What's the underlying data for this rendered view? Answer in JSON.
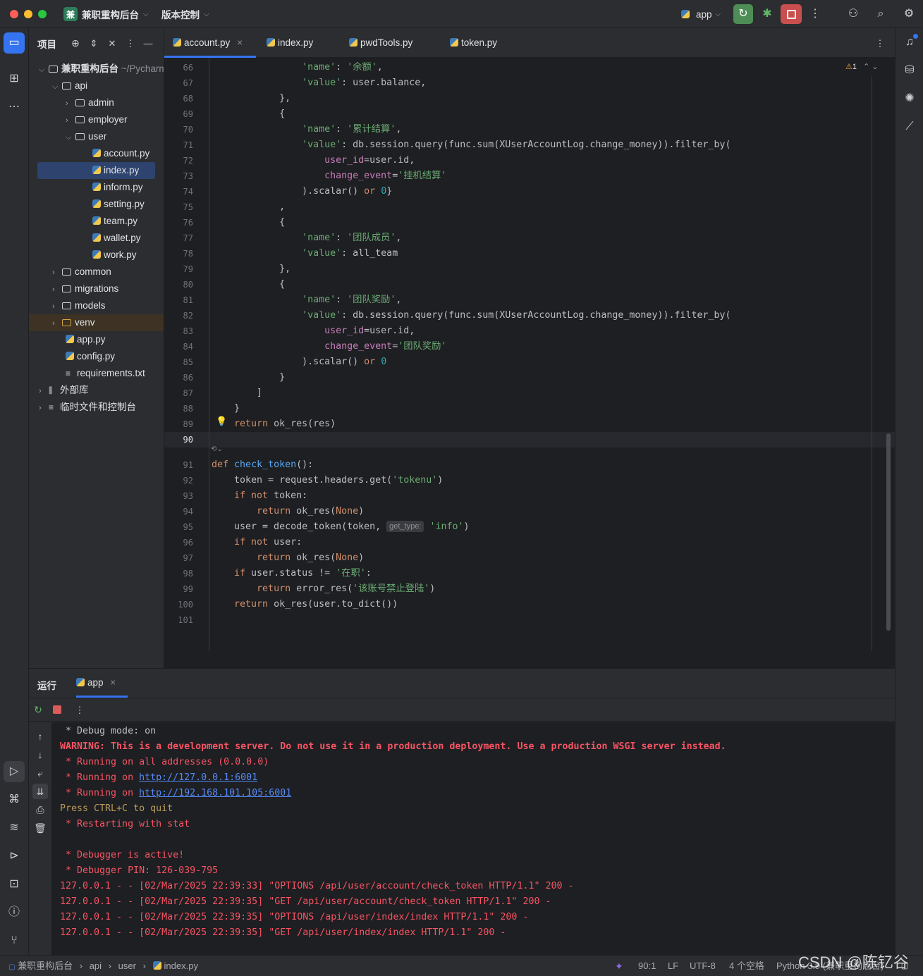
{
  "titlebar": {
    "project_badge": "兼",
    "project_name": "兼职重构后台",
    "vcs": "版本控制",
    "run_config": "app"
  },
  "project_panel": {
    "title": "项目",
    "root": "兼职重构后台",
    "root_path": "~/PycharmProjects",
    "items": [
      "api",
      "admin",
      "employer",
      "user",
      "account.py",
      "index.py",
      "inform.py",
      "setting.py",
      "team.py",
      "wallet.py",
      "work.py",
      "common",
      "migrations",
      "models",
      "venv",
      "app.py",
      "config.py",
      "requirements.txt",
      "外部库",
      "临时文件和控制台"
    ]
  },
  "tabs": [
    "account.py",
    "index.py",
    "pwdTools.py",
    "token.py"
  ],
  "editor": {
    "warning_count": "1",
    "param_hint": "get_type:",
    "line_numbers": [
      "66",
      "67",
      "68",
      "69",
      "70",
      "71",
      "72",
      "73",
      "74",
      "75",
      "76",
      "77",
      "78",
      "79",
      "80",
      "81",
      "82",
      "83",
      "84",
      "85",
      "86",
      "87",
      "88",
      "89",
      "90",
      "91",
      "92",
      "93",
      "94",
      "95",
      "96",
      "97",
      "98",
      "99",
      "100",
      "101"
    ]
  },
  "run_panel": {
    "title": "运行",
    "tab": "app",
    "console": [
      " * Debug mode: on",
      "WARNING: This is a development server. Do not use it in a production deployment. Use a production WSGI server instead.",
      " * Running on all addresses (0.0.0.0)",
      " * Running on ",
      "http://127.0.0.1:6001",
      " * Running on ",
      "http://192.168.101.105:6001",
      "Press CTRL+C to quit",
      " * Restarting with stat",
      " * Debugger is active!",
      " * Debugger PIN: 126-039-795",
      "127.0.0.1 - - [02/Mar/2025 22:39:33] \"OPTIONS /api/user/account/check_token HTTP/1.1\" 200 -",
      "127.0.0.1 - - [02/Mar/2025 22:39:35] \"GET /api/user/account/check_token HTTP/1.1\" 200 -",
      "127.0.0.1 - - [02/Mar/2025 22:39:35] \"OPTIONS /api/user/index/index HTTP/1.1\" 200 -",
      "127.0.0.1 - - [02/Mar/2025 22:39:35] \"GET /api/user/index/index HTTP/1.1\" 200 -"
    ]
  },
  "statusbar": {
    "breadcrumb": [
      "兼职重构后台",
      "api",
      "user",
      "index.py"
    ],
    "position": "90:1",
    "line_sep": "LF",
    "encoding": "UTF-8",
    "indent": "4 个空格",
    "interpreter": "Python 3.9 (兼职重构后台)",
    "watermark": "CSDN @陈钇谷"
  },
  "colors": {
    "accent": "#3574f0",
    "keyword": "#cf8e6d",
    "string": "#6aab73",
    "number": "#2aacb8",
    "function": "#56a8f5",
    "param": "#c77dbb",
    "error": "#f75464",
    "run_green": "#5fb865",
    "stop_red": "#db5c5c"
  }
}
